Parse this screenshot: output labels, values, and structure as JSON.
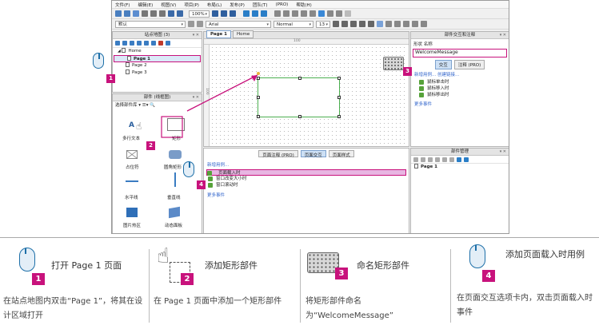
{
  "menu": [
    "文件(F)",
    "编辑(E)",
    "视图(V)",
    "项目(P)",
    "布局(L)",
    "发布(P)",
    "团队(T)",
    "(PRO)",
    "帮助(H)"
  ],
  "toolbar": {
    "zoom": "100%",
    "style": "默认",
    "font": "Arial",
    "weight": "Normal",
    "size": "13"
  },
  "sitemap": {
    "title": "站点地图 (3)",
    "pages": [
      "Home",
      "Page 1",
      "Page 2",
      "Page 3"
    ]
  },
  "widgets": {
    "title": "部件 (线框图)",
    "library": "选择部件库",
    "items": [
      "多行文本",
      "矩形",
      "占位符",
      "圆角矩形",
      "水平线",
      "垂直线",
      "图片热区",
      "动态面板"
    ]
  },
  "canvas": {
    "tabs": [
      "Page 1",
      "Home"
    ],
    "ruler_h": "100",
    "ruler_v": "100"
  },
  "page_props": {
    "tabs": [
      "页面注释 (PRO)",
      "页面交互",
      "页面样式"
    ],
    "new_case": "新增用例...",
    "events": [
      "页面载入时",
      "窗口改变大小时",
      "窗口滚动时"
    ],
    "more": "更多事件"
  },
  "interact": {
    "title": "部件交互和注释",
    "name_label": "形状 名称",
    "name_value": "WelcomeMessage",
    "tabs": [
      "交互",
      "注释 (PRO)"
    ],
    "new_case": "新增用例... 创建链接...",
    "events": [
      "鼠标单击时",
      "鼠标移入时",
      "鼠标移出时"
    ],
    "more": "更多事件"
  },
  "manager": {
    "title": "部件管理",
    "item": "Page 1"
  },
  "steps": [
    {
      "num": "1",
      "title": "打开 Page 1 页面",
      "desc": "在站点地图内双击“Page 1”，将其在设计区域打开"
    },
    {
      "num": "2",
      "title": "添加矩形部件",
      "desc": "在 Page 1 页面中添加一个矩形部件"
    },
    {
      "num": "3",
      "title": "命名矩形部件",
      "desc": "将矩形部件命名为“WelcomeMessage”"
    },
    {
      "num": "4",
      "title": "添加页面载入时用例",
      "desc": "在页面交互选项卡内，双击页面载入时事件"
    }
  ],
  "colors": {
    "badge": "#c8127c",
    "highlight": "#e8b6e2",
    "accent": "#1d6fa8"
  }
}
